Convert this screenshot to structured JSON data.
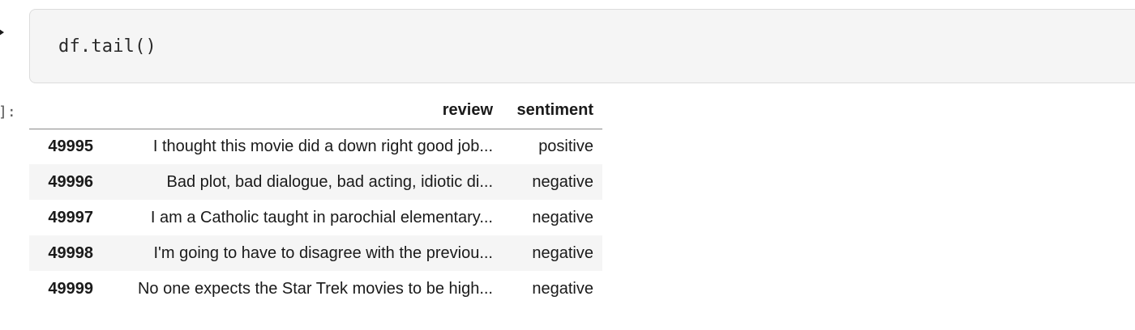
{
  "cell": {
    "code": "df.tail()",
    "prompt": "]:"
  },
  "dataframe": {
    "columns": [
      "",
      "review",
      "sentiment"
    ],
    "rows": [
      {
        "index": "49995",
        "review": "I thought this movie did a down right good job...",
        "sentiment": "positive"
      },
      {
        "index": "49996",
        "review": "Bad plot, bad dialogue, bad acting, idiotic di...",
        "sentiment": "negative"
      },
      {
        "index": "49997",
        "review": "I am a Catholic taught in parochial elementary...",
        "sentiment": "negative"
      },
      {
        "index": "49998",
        "review": "I'm going to have to disagree with the previou...",
        "sentiment": "negative"
      },
      {
        "index": "49999",
        "review": "No one expects the Star Trek movies to be high...",
        "sentiment": "negative"
      }
    ]
  }
}
